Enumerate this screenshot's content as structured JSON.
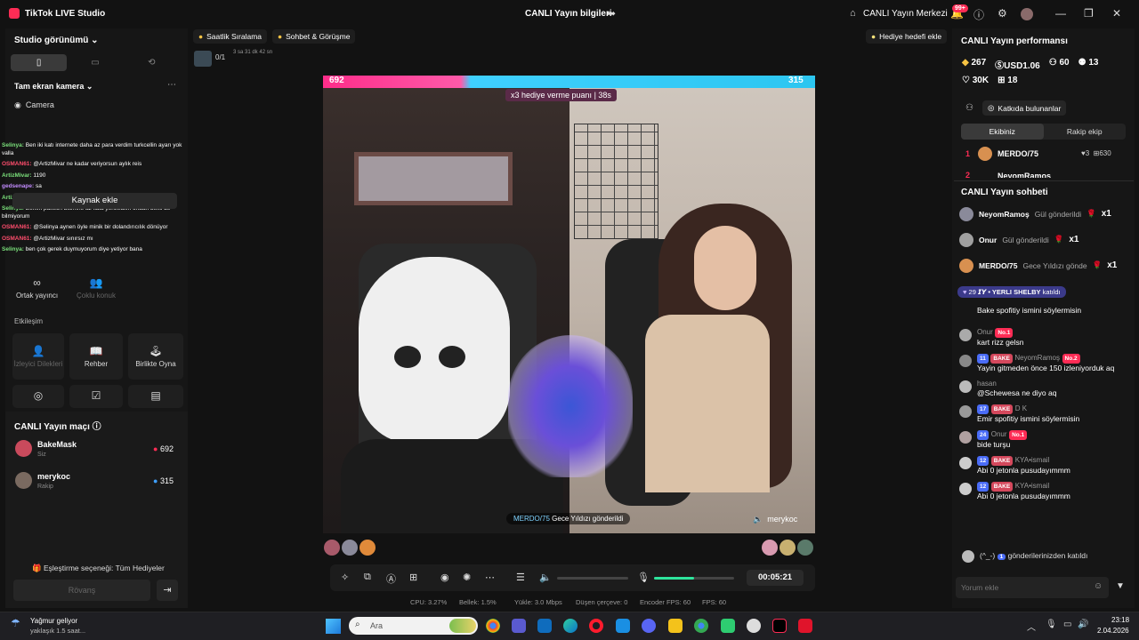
{
  "titlebar": {
    "app": "TikTok LIVE Studio",
    "center": "CANLI Yayın bilgileri",
    "live_center": "CANLI Yayın Merkezi",
    "badge": "99+"
  },
  "left": {
    "studio_view": "Studio görünümü",
    "camera_mode": "Tam ekran kamera",
    "camera": "Camera",
    "add_source": "Kaynak ekle",
    "overlay_chat": [
      {
        "user": "Selinya:",
        "text": "Ben iki katı internete daha az para verdim turkcellin ayarı yok valla",
        "color": "#7be07b"
      },
      {
        "user": "OSMAN61:",
        "text": "@ArtizMivar ne kadar veriyorsun aylık reis",
        "color": "#ff4d6d"
      },
      {
        "user": "ArtizMivar:",
        "text": "1190",
        "color": "#7be07b"
      },
      {
        "user": "gedsenape:",
        "text": "sa",
        "color": "#c38cff"
      },
      {
        "user": "ArtizMivar:",
        "text": "06",
        "color": "#7be07b"
      },
      {
        "user": "Selinya:",
        "text": "Benim paketin bitimine az kala yenilediim ondan belki de bilmiyorum",
        "color": "#7be07b"
      },
      {
        "user": "OSMAN61:",
        "text": "@Selinya aynen öyle minik bir dolandırıcılık dönüyor",
        "color": "#ff4d6d"
      },
      {
        "user": "OSMAN61:",
        "text": "@ArtizMivar sınırsız mı",
        "color": "#ff4d6d"
      },
      {
        "user": "Selinya:",
        "text": "ben çok gerek duymuyorum diye yetiyor bana",
        "color": "#7be07b"
      }
    ],
    "cohost": "Ortak yayıncı",
    "multi_guest": "Çoklu konuk",
    "interaction": "Etkileşim",
    "viewer_requests": "İzleyici Dilekleri",
    "guide": "Rehber",
    "play_together": "Birlikte Oyna",
    "match_title": "CANLI Yayın maçı",
    "match": [
      {
        "name": "BakeMask",
        "sub": "Siz",
        "score": "692"
      },
      {
        "name": "merykoc",
        "sub": "Rakip",
        "score": "315"
      }
    ],
    "pairing": "Eşleştirme seçeneği: Tüm Hediyeler",
    "rematch": "Rövanş"
  },
  "topbar": {
    "hourly": "Saatlik Sıralama",
    "chat_meet": "Sohbet & Görüşme",
    "goal": "0/1",
    "goal_time": "3 sa 31 dk 42 sn",
    "gift_goal": "Hediye hedefi ekle"
  },
  "video": {
    "score_left": "692",
    "score_right": "315",
    "multiplier": "x3 hediye verme puanı",
    "timer": "38s",
    "gift_user": "MERDO/75",
    "gift_text": "Gece Yıldızı gönderildi",
    "opponent": "merykoc"
  },
  "controls": {
    "time": "00:05:21"
  },
  "stats": {
    "cpu": "CPU: 3.27%",
    "mem": "Bellek: 1.5%",
    "upload": "Yükle: 3.0 Mbps",
    "dropped": "Düşen çerçeve: 0",
    "encfps": "Encoder FPS: 60",
    "fps": "FPS: 60"
  },
  "right": {
    "perf_title": "CANLI Yayın performansı",
    "coins": "267",
    "usd": "USD1.06",
    "followers": "60",
    "gifters": "13",
    "likes": "30K",
    "gifts": "18",
    "contributors": "Katkıda bulunanlar",
    "our_team": "Ekibiniz",
    "rival_team": "Rakip ekip",
    "rank1": {
      "n": "1",
      "name": "MERDO/75",
      "a": "3",
      "b": "630"
    },
    "rank2": {
      "n": "2",
      "name": "NeyomRamos"
    },
    "chat_title": "CANLI Yayın sohbeti",
    "gifts_list": [
      {
        "user": "NeyomRamoş",
        "text": "Gül gönderildi",
        "x": "x1"
      },
      {
        "user": "Onur",
        "text": "Gül gönderildi",
        "x": "x1"
      },
      {
        "user": "MERDO/75",
        "text": "Gece Yıldızı gönde",
        "x": "x1"
      }
    ],
    "joined_lvl": "29",
    "joined_name": "𝙄𝙔 • YERLI SHELBY",
    "joined_text": "katıldı",
    "chat": [
      {
        "lvl": "",
        "fan": "",
        "user": "",
        "text": "Bake spofitiy ismini söylermisin"
      },
      {
        "lvl": "",
        "fan": "No.1",
        "user": "Onur",
        "text": "kart rizz gelsn"
      },
      {
        "lvl": "11",
        "fan": "BAKE",
        "user": "NeyomRamoş",
        "rank": "No.2",
        "text": "Yayin gitmeden önce 150 izleniyorduk aq"
      },
      {
        "lvl": "",
        "fan": "",
        "user": "hasan",
        "text": "@Schewesa ne diyo aq"
      },
      {
        "lvl": "17",
        "fan": "BAKE",
        "user": "D K",
        "text": "Emir spofitiy ismini söylermisin"
      },
      {
        "lvl": "24",
        "fan": "No.1",
        "user": "Onur",
        "text": "bide turşu"
      },
      {
        "lvl": "12",
        "fan": "BAKE",
        "user": "KYA•ismail",
        "text": "Abi 0 jetonla pusudayımmm"
      },
      {
        "lvl": "12",
        "fan": "BAKE",
        "user": "KYA•ismail",
        "text": "Abi 0 jetonla pusudayımmm"
      }
    ],
    "last_user": "(^_-)",
    "last_lvl": "1",
    "last_text": "gönderilerinizden katıldı",
    "comment_placeholder": "Yorum ekle"
  },
  "taskbar": {
    "weather": "Yağmur geliyor",
    "weather_sub": "yaklaşık 1.5 saat...",
    "search": "Ara",
    "time": "23:18",
    "date": "2.04.2026"
  }
}
